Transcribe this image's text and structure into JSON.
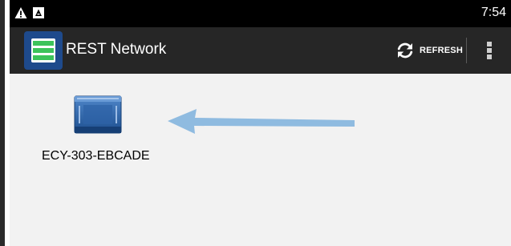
{
  "status_bar": {
    "time": "7:54",
    "icons": [
      "warning-icon",
      "notification-icon"
    ]
  },
  "app_bar": {
    "title": "REST Network",
    "app_icon": "list-icon",
    "refresh_label": "REFRESH",
    "refresh_icon": "refresh-icon",
    "overflow_icon": "more-vert-icon"
  },
  "devices": [
    {
      "label": "ECY-303-EBCADE",
      "icon": "controller-device-icon"
    }
  ],
  "colors": {
    "status_bar": "#000000",
    "app_bar": "#262626",
    "app_icon_bg": "#1e4a8c",
    "app_icon_accent": "#3cc35a",
    "content_bg": "#f2f2f2",
    "arrow": "#8fbbe0"
  }
}
